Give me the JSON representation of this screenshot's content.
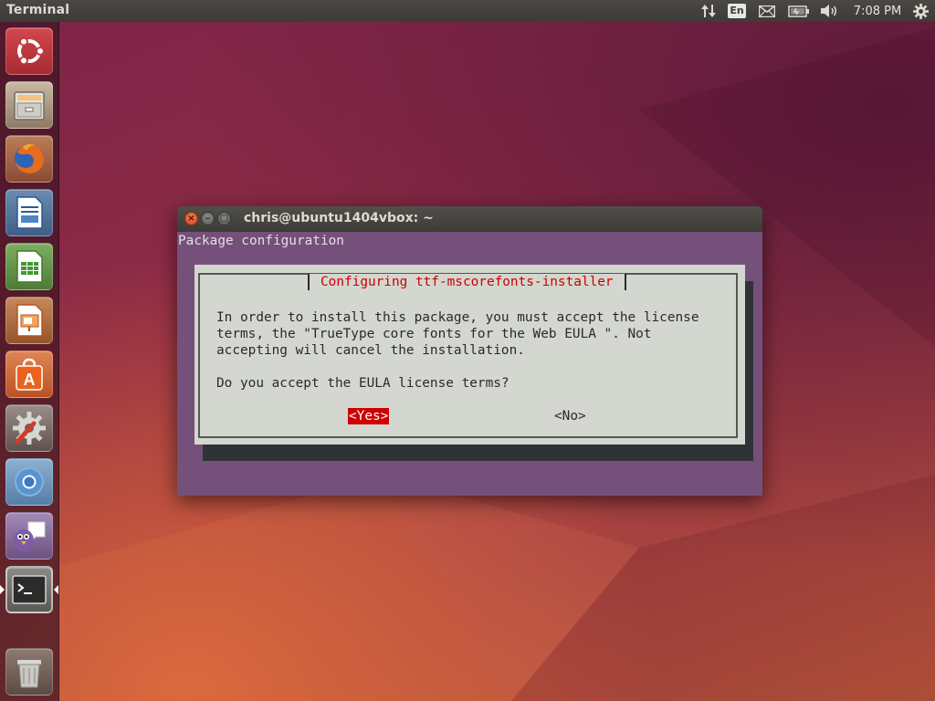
{
  "top_panel": {
    "app_title": "Terminal",
    "keyboard_layout": "En",
    "clock": "7:08 PM"
  },
  "launcher": {
    "items": [
      {
        "name": "dash-home",
        "icon": "ubuntu-logo-icon"
      },
      {
        "name": "files",
        "icon": "file-cabinet-icon"
      },
      {
        "name": "firefox",
        "icon": "firefox-icon"
      },
      {
        "name": "libreoffice-writer",
        "icon": "writer-document-icon"
      },
      {
        "name": "libreoffice-calc",
        "icon": "calc-spreadsheet-icon"
      },
      {
        "name": "libreoffice-impress",
        "icon": "impress-presentation-icon"
      },
      {
        "name": "ubuntu-software-center",
        "icon": "software-center-bag-icon"
      },
      {
        "name": "system-settings",
        "icon": "settings-gear-wrench-icon"
      },
      {
        "name": "chromium",
        "icon": "chromium-icon"
      },
      {
        "name": "pidgin",
        "icon": "pidgin-bird-icon"
      },
      {
        "name": "terminal",
        "icon": "terminal-icon",
        "active": true
      },
      {
        "name": "trash",
        "icon": "trash-icon"
      }
    ]
  },
  "window": {
    "title": "chris@ubuntu1404vbox: ~",
    "close_glyph": "×",
    "minimize_glyph": "–",
    "maximize_glyph": "□"
  },
  "terminal": {
    "backtitle": "Package configuration",
    "dialog": {
      "title": "Configuring ttf-mscorefonts-installer",
      "message": "In order to install this package, you must accept the license\nterms, the \"TrueType core fonts for the Web EULA \". Not\naccepting will cancel the installation.",
      "question": "Do you accept the EULA license terms?",
      "yes_label": "<Yes>",
      "no_label": "<No>"
    }
  },
  "colors": {
    "panel": "#3c3b37",
    "terminal_background": "#75507b",
    "dialog_background": "#d3d7cf",
    "dialog_title": "#cc0000",
    "selected_button": "#cc0000"
  }
}
